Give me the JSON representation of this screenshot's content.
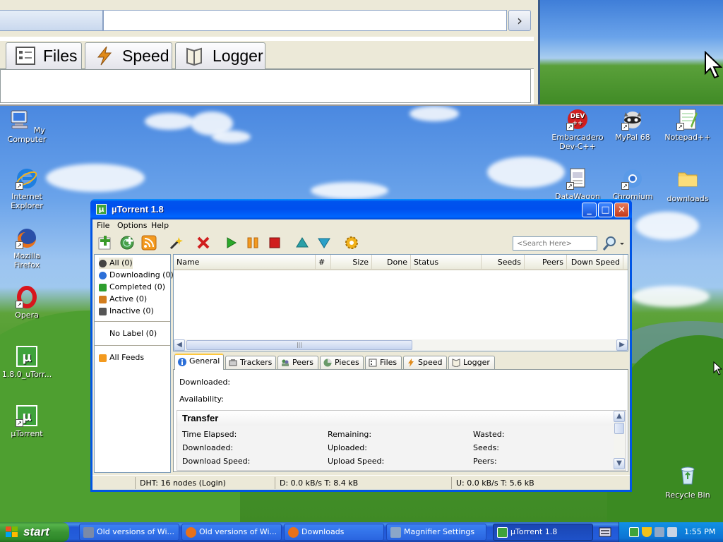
{
  "magnifier": {
    "tabs": [
      "Files",
      "Speed",
      "Logger"
    ],
    "arrow": "›"
  },
  "desktop_icons": {
    "my_computer": "My Computer",
    "internet_explorer": "Internet Explorer",
    "firefox": "Mozilla Firefox",
    "opera": "Opera",
    "utorrent_installer": "1.8.0_uTorr...",
    "utorrent": "µTorrent",
    "devcpp": "Embarcadero Dev-C++",
    "mypal": "MyPal 68",
    "notepadpp": "Notepad++",
    "datawagon": "DataWagon",
    "chromium": "Chromium",
    "downloads": "downloads",
    "recycle_bin": "Recycle Bin"
  },
  "window": {
    "title": "µTorrent 1.8",
    "icon_glyph": "µ",
    "controls": {
      "minimize": "_",
      "maximize": "□",
      "close": "✕"
    }
  },
  "menu": [
    "File",
    "Options",
    "Help"
  ],
  "search": {
    "placeholder": "<Search Here>"
  },
  "sidebar": {
    "categories": [
      {
        "label": "All (0)",
        "color": "#444444"
      },
      {
        "label": "Downloading (0)",
        "color": "#2c6fd8"
      },
      {
        "label": "Completed (0)",
        "color": "#2e9e2e"
      },
      {
        "label": "Active (0)",
        "color": "#d27d1e"
      },
      {
        "label": "Inactive (0)",
        "color": "#555555"
      }
    ],
    "label_item": "No Label (0)",
    "feeds_item": "All Feeds"
  },
  "list": {
    "columns": [
      "Name",
      "#",
      "Size",
      "Done",
      "Status",
      "Seeds",
      "Peers",
      "Down Speed"
    ],
    "scroll_grip": "|||"
  },
  "tabs": [
    {
      "label": "General",
      "active": true
    },
    {
      "label": "Trackers",
      "active": false
    },
    {
      "label": "Peers",
      "active": false
    },
    {
      "label": "Pieces",
      "active": false
    },
    {
      "label": "Files",
      "active": false
    },
    {
      "label": "Speed",
      "active": false
    },
    {
      "label": "Logger",
      "active": false
    }
  ],
  "general": {
    "downloaded": "Downloaded:",
    "availability": "Availability:",
    "transfer_title": "Transfer",
    "fields": {
      "time_elapsed": "Time Elapsed:",
      "remaining": "Remaining:",
      "wasted": "Wasted:",
      "downloaded": "Downloaded:",
      "uploaded": "Uploaded:",
      "seeds": "Seeds:",
      "download_speed": "Download Speed:",
      "upload_speed": "Upload Speed:",
      "peers": "Peers:"
    }
  },
  "statusbar": {
    "dht": "DHT: 16 nodes (Login)",
    "download": "D: 0.0 kB/s T: 8.4 kB",
    "upload": "U: 0.0 kB/s T: 5.6 kB"
  },
  "taskbar": {
    "start": "start",
    "tasks": [
      "Old versions of Wi...",
      "Old versions of Wi...",
      "Downloads",
      "Magnifier Settings",
      "µTorrent 1.8"
    ],
    "clock": "1:55 PM"
  },
  "colors": {
    "xp_blue": "#0054e3",
    "utorrent_green": "#3fa33b",
    "start_green": "#3a9433"
  }
}
